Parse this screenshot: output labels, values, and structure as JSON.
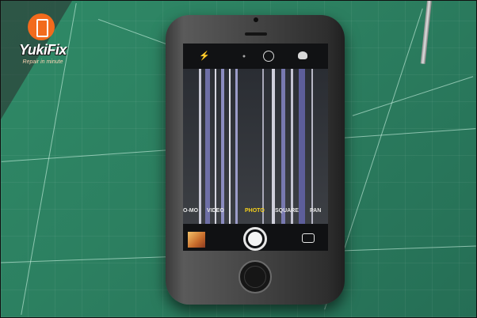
{
  "logo": {
    "brand": "YukiFix",
    "tagline": "Repair in minute",
    "colors": {
      "badge": "#f26b1d",
      "text": "#ffffff"
    }
  },
  "camera_app": {
    "top_icons": [
      "flash-off-icon",
      "hdr-icon",
      "timer-icon",
      "filter-icon"
    ],
    "modes": [
      {
        "label": "O-MO",
        "active": false
      },
      {
        "label": "VIDEO",
        "active": false
      },
      {
        "label": "PHOTO",
        "active": true
      },
      {
        "label": "SQUARE",
        "active": false
      },
      {
        "label": "PAN",
        "active": false
      }
    ],
    "active_mode_color": "#f6d01c"
  },
  "colors": {
    "mat": "#2c7f60",
    "phone_body": "#3a3a3a"
  }
}
